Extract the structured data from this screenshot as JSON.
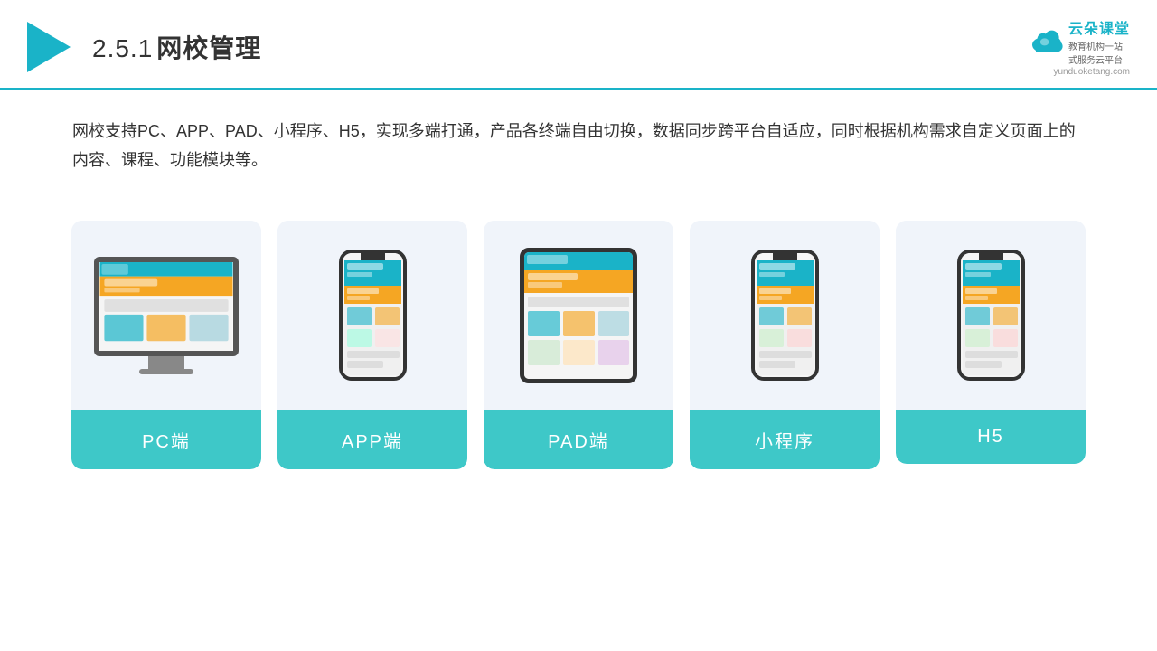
{
  "header": {
    "title_num": "2.5.1",
    "title_text": "网校管理",
    "brand_name": "云朵课堂",
    "brand_url": "yunduoketang.com",
    "brand_slogan": "教育机构一站\n式服务云平台"
  },
  "description": {
    "text": "网校支持PC、APP、PAD、小程序、H5，实现多端打通，产品各终端自由切换，数据同步跨平台自适应，同时根据机构需求自定义页面上的内容、课程、功能模块等。"
  },
  "cards": [
    {
      "id": "pc",
      "label": "PC端"
    },
    {
      "id": "app",
      "label": "APP端"
    },
    {
      "id": "pad",
      "label": "PAD端"
    },
    {
      "id": "miniapp",
      "label": "小程序"
    },
    {
      "id": "h5",
      "label": "H5"
    }
  ],
  "colors": {
    "accent": "#1ab3c8",
    "orange": "#f5a623",
    "card_bg": "#f0f4fa",
    "label_bg": "#3ec8c8"
  }
}
